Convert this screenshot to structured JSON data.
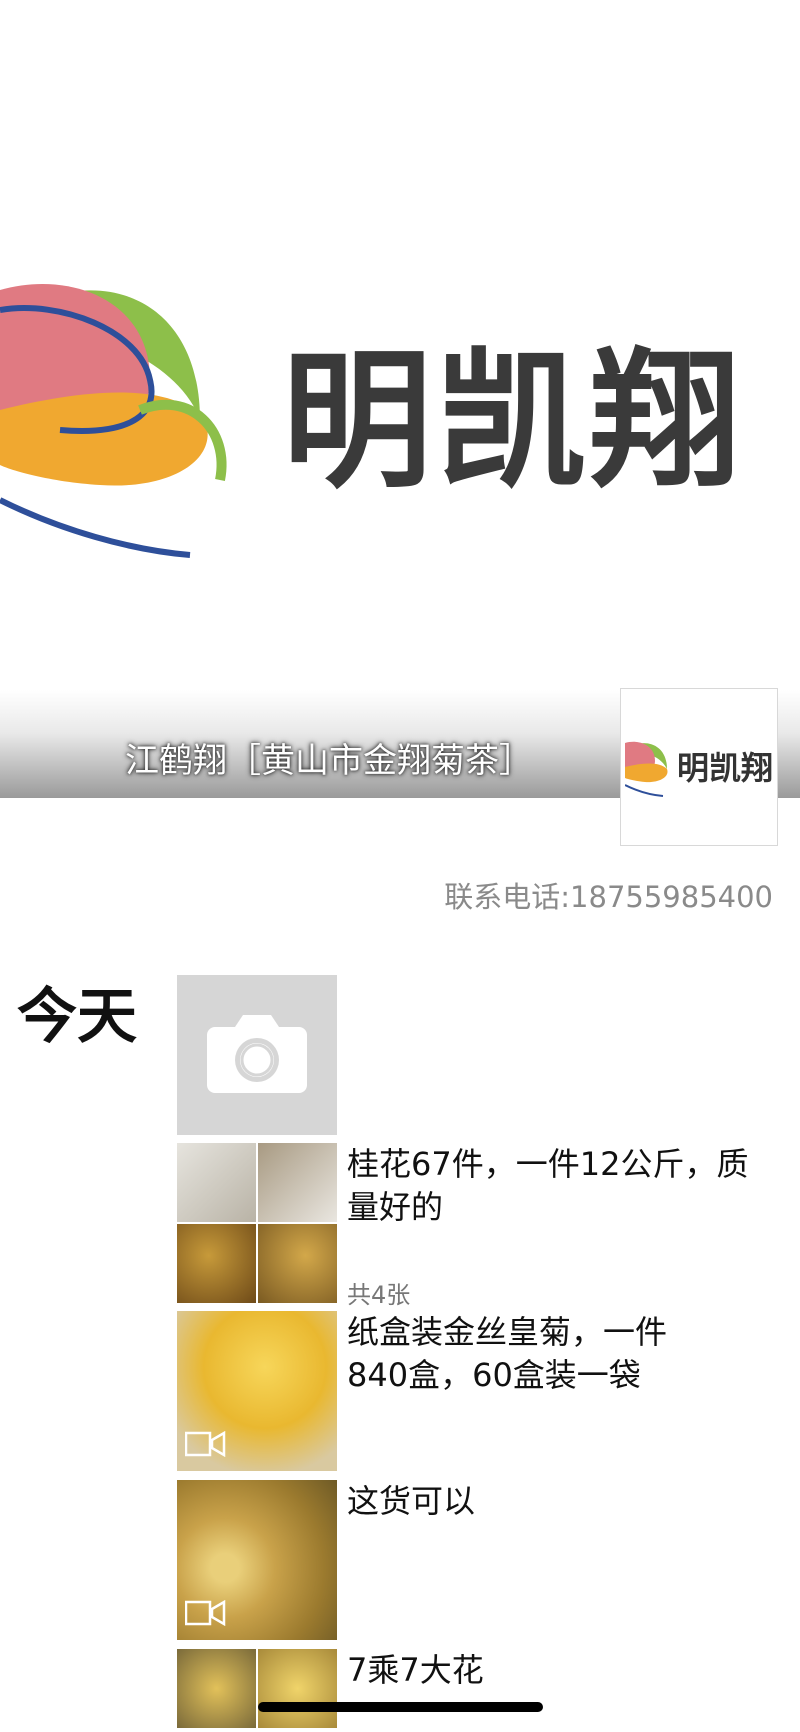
{
  "cover": {
    "brand_text": "明凯翔",
    "profile_name": "江鹤翔［黄山市金翔菊茶］",
    "avatar_text": "明凯翔"
  },
  "contact": {
    "phone": "联系电话:18755985400"
  },
  "timeline": {
    "day_label": "今天",
    "posts": [
      {
        "text": "桂花67件，一件12公斤，质量好的",
        "count": "共4张"
      },
      {
        "text": "纸盒装金丝皇菊，一件840盒，60盒装一袋"
      },
      {
        "text": "这货可以"
      },
      {
        "text": "7乘7大花"
      }
    ]
  },
  "colors": {
    "logo_pink": "#e07a82",
    "logo_green": "#8dbf4a",
    "logo_orange": "#f0a830",
    "logo_blue": "#2e4f9a"
  }
}
